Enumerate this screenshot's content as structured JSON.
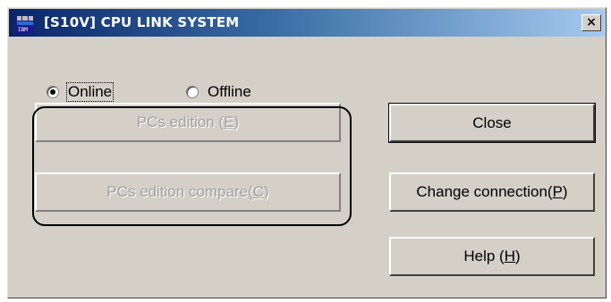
{
  "window": {
    "title": "[S10V] CPU LINK SYSTEM",
    "close_glyph": "×",
    "app_icon": "cpu-link-system-icon"
  },
  "mode": {
    "options": [
      {
        "label": "Online",
        "selected": true
      },
      {
        "label": "Offline",
        "selected": false
      }
    ]
  },
  "buttons": {
    "pcs_edition": {
      "text": "PCs edition (",
      "mnemonic": "E",
      "suffix": ")",
      "enabled": false
    },
    "pcs_edition_compare": {
      "text": "PCs edition compare(",
      "mnemonic": "C",
      "suffix": ")",
      "enabled": false
    },
    "close": {
      "text": "Close",
      "enabled": true
    },
    "change_connection": {
      "text": "Change connection(",
      "mnemonic": "P",
      "suffix": ")",
      "enabled": true
    },
    "help": {
      "text": "Help (",
      "mnemonic": "H",
      "suffix": ")",
      "enabled": true
    }
  },
  "colors": {
    "title_gradient_start": "#0a246a",
    "title_gradient_end": "#a6caf0",
    "dialog_bg": "#d4d0c8",
    "disabled_text": "#a0a0a0"
  }
}
